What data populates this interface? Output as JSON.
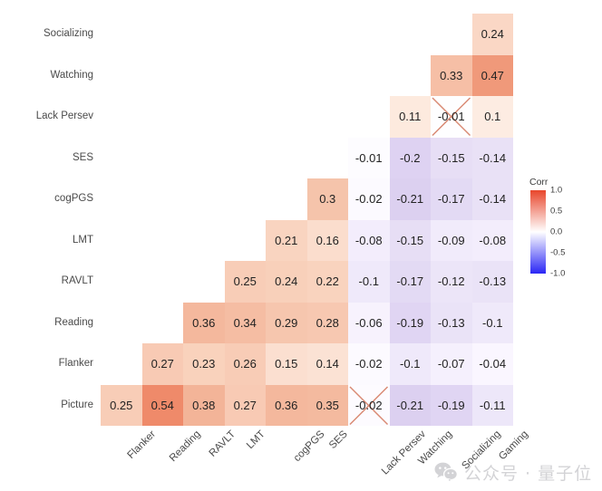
{
  "chart_data": {
    "type": "heatmap",
    "title": "",
    "xlabel": "",
    "ylabel": "",
    "legend": {
      "title": "Corr",
      "position": "right",
      "ticks": [
        "1.0",
        "0.5",
        "0.0",
        "-0.5",
        "-1.0"
      ],
      "tick_values": [
        1.0,
        0.5,
        0.0,
        -0.5,
        -1.0
      ],
      "vmin": -1.0,
      "vmax": 1.0,
      "color_high": "#e8462b",
      "color_mid": "#ffffff",
      "color_low": "#2a26f5"
    },
    "x_categories": [
      "Flanker",
      "Reading",
      "RAVLT",
      "LMT",
      "cogPGS",
      "SES",
      "Lack Persev",
      "Watching",
      "Socializing",
      "Gaming"
    ],
    "y_categories": [
      "Socializing",
      "Watching",
      "Lack Persev",
      "SES",
      "cogPGS",
      "LMT",
      "RAVLT",
      "Reading",
      "Flanker",
      "Picture"
    ],
    "lower_triangle_only": true,
    "nonsignificant_marker": "x-cross",
    "cells": [
      {
        "row": 0,
        "col": 9,
        "value": 0.24,
        "label": "0.24",
        "color": "#fad7c5",
        "crossed": false
      },
      {
        "row": 1,
        "col": 8,
        "value": 0.33,
        "label": "0.33",
        "color": "#f6bfa6",
        "crossed": false
      },
      {
        "row": 1,
        "col": 9,
        "value": 0.47,
        "label": "0.47",
        "color": "#f0997a",
        "crossed": false
      },
      {
        "row": 2,
        "col": 7,
        "value": 0.11,
        "label": "0.11",
        "color": "#fdeade",
        "crossed": false
      },
      {
        "row": 2,
        "col": 8,
        "value": -0.01,
        "label": "-0.01",
        "color": "#fefeff",
        "crossed": true
      },
      {
        "row": 2,
        "col": 9,
        "value": 0.1,
        "label": "0.1",
        "color": "#fdece2",
        "crossed": false
      },
      {
        "row": 3,
        "col": 6,
        "value": -0.01,
        "label": "-0.01",
        "color": "#fdfcff",
        "crossed": false
      },
      {
        "row": 3,
        "col": 7,
        "value": -0.2,
        "label": "-0.2",
        "color": "#ded2f2",
        "crossed": false
      },
      {
        "row": 3,
        "col": 8,
        "value": -0.15,
        "label": "-0.15",
        "color": "#e7def5",
        "crossed": false
      },
      {
        "row": 3,
        "col": 9,
        "value": -0.14,
        "label": "-0.14",
        "color": "#e9e1f6",
        "crossed": false
      },
      {
        "row": 4,
        "col": 5,
        "value": 0.3,
        "label": "0.3",
        "color": "#f5c4ab",
        "crossed": false
      },
      {
        "row": 4,
        "col": 6,
        "value": -0.02,
        "label": "-0.02",
        "color": "#fcfaff",
        "crossed": false
      },
      {
        "row": 4,
        "col": 7,
        "value": -0.21,
        "label": "-0.21",
        "color": "#dcd0f0",
        "crossed": false
      },
      {
        "row": 4,
        "col": 8,
        "value": -0.17,
        "label": "-0.17",
        "color": "#e3daf4",
        "crossed": false
      },
      {
        "row": 4,
        "col": 9,
        "value": -0.14,
        "label": "-0.14",
        "color": "#e9e1f6",
        "crossed": false
      },
      {
        "row": 5,
        "col": 4,
        "value": 0.21,
        "label": "0.21",
        "color": "#f9d4c0",
        "crossed": false
      },
      {
        "row": 5,
        "col": 5,
        "value": 0.16,
        "label": "0.16",
        "color": "#fbddcd",
        "crossed": false
      },
      {
        "row": 5,
        "col": 6,
        "value": -0.08,
        "label": "-0.08",
        "color": "#f3edfc",
        "crossed": false
      },
      {
        "row": 5,
        "col": 7,
        "value": -0.15,
        "label": "-0.15",
        "color": "#e7def5",
        "crossed": false
      },
      {
        "row": 5,
        "col": 8,
        "value": -0.09,
        "label": "-0.09",
        "color": "#f1ebfb",
        "crossed": false
      },
      {
        "row": 5,
        "col": 9,
        "value": -0.08,
        "label": "-0.08",
        "color": "#f3edfc",
        "crossed": false
      },
      {
        "row": 6,
        "col": 3,
        "value": 0.25,
        "label": "0.25",
        "color": "#f8cdb7",
        "crossed": false
      },
      {
        "row": 6,
        "col": 4,
        "value": 0.24,
        "label": "0.24",
        "color": "#f8d0ba",
        "crossed": false
      },
      {
        "row": 6,
        "col": 5,
        "value": 0.22,
        "label": "0.22",
        "color": "#f9d3be",
        "crossed": false
      },
      {
        "row": 6,
        "col": 6,
        "value": -0.1,
        "label": "-0.1",
        "color": "#efe9fa",
        "crossed": false
      },
      {
        "row": 6,
        "col": 7,
        "value": -0.17,
        "label": "-0.17",
        "color": "#e3daf4",
        "crossed": false
      },
      {
        "row": 6,
        "col": 8,
        "value": -0.12,
        "label": "-0.12",
        "color": "#ece5f8",
        "crossed": false
      },
      {
        "row": 6,
        "col": 9,
        "value": -0.13,
        "label": "-0.13",
        "color": "#eae3f7",
        "crossed": false
      },
      {
        "row": 7,
        "col": 2,
        "value": 0.36,
        "label": "0.36",
        "color": "#f4b89d",
        "crossed": false
      },
      {
        "row": 7,
        "col": 3,
        "value": 0.34,
        "label": "0.34",
        "color": "#f5bda3",
        "crossed": false
      },
      {
        "row": 7,
        "col": 4,
        "value": 0.29,
        "label": "0.29",
        "color": "#f6c6ae",
        "crossed": false
      },
      {
        "row": 7,
        "col": 5,
        "value": 0.28,
        "label": "0.28",
        "color": "#f7c8b1",
        "crossed": false
      },
      {
        "row": 7,
        "col": 6,
        "value": -0.06,
        "label": "-0.06",
        "color": "#f7f2fd",
        "crossed": false
      },
      {
        "row": 7,
        "col": 7,
        "value": -0.19,
        "label": "-0.19",
        "color": "#e0d5f3",
        "crossed": false
      },
      {
        "row": 7,
        "col": 8,
        "value": -0.13,
        "label": "-0.13",
        "color": "#eae3f7",
        "crossed": false
      },
      {
        "row": 7,
        "col": 9,
        "value": -0.1,
        "label": "-0.1",
        "color": "#efe9fa",
        "crossed": false
      },
      {
        "row": 8,
        "col": 1,
        "value": 0.27,
        "label": "0.27",
        "color": "#f8cab4",
        "crossed": false
      },
      {
        "row": 8,
        "col": 2,
        "value": 0.23,
        "label": "0.23",
        "color": "#f9d2bc",
        "crossed": false
      },
      {
        "row": 8,
        "col": 3,
        "value": 0.26,
        "label": "0.26",
        "color": "#f8ccb6",
        "crossed": false
      },
      {
        "row": 8,
        "col": 4,
        "value": 0.15,
        "label": "0.15",
        "color": "#fbdfd0",
        "crossed": false
      },
      {
        "row": 8,
        "col": 5,
        "value": 0.14,
        "label": "0.14",
        "color": "#fbe2d4",
        "crossed": false
      },
      {
        "row": 8,
        "col": 6,
        "value": -0.02,
        "label": "-0.02",
        "color": "#fcfaff",
        "crossed": false
      },
      {
        "row": 8,
        "col": 7,
        "value": -0.1,
        "label": "-0.1",
        "color": "#efe9fa",
        "crossed": false
      },
      {
        "row": 8,
        "col": 8,
        "value": -0.07,
        "label": "-0.07",
        "color": "#f5f0fd",
        "crossed": false
      },
      {
        "row": 8,
        "col": 9,
        "value": -0.04,
        "label": "-0.04",
        "color": "#faf6ff",
        "crossed": false
      },
      {
        "row": 9,
        "col": 0,
        "value": 0.25,
        "label": "0.25",
        "color": "#f8cdb7",
        "crossed": false
      },
      {
        "row": 9,
        "col": 1,
        "value": 0.54,
        "label": "0.54",
        "color": "#ef8a6a",
        "crossed": false
      },
      {
        "row": 9,
        "col": 2,
        "value": 0.38,
        "label": "0.38",
        "color": "#f3b498",
        "crossed": false
      },
      {
        "row": 9,
        "col": 3,
        "value": 0.27,
        "label": "0.27",
        "color": "#f8cab4",
        "crossed": false
      },
      {
        "row": 9,
        "col": 4,
        "value": 0.36,
        "label": "0.36",
        "color": "#f4b89d",
        "crossed": false
      },
      {
        "row": 9,
        "col": 5,
        "value": 0.35,
        "label": "0.35",
        "color": "#f4ba9f",
        "crossed": false
      },
      {
        "row": 9,
        "col": 6,
        "value": -0.02,
        "label": "-0.02",
        "color": "#fdfbff",
        "crossed": true
      },
      {
        "row": 9,
        "col": 7,
        "value": -0.21,
        "label": "-0.21",
        "color": "#dcd0f0",
        "crossed": false
      },
      {
        "row": 9,
        "col": 8,
        "value": -0.19,
        "label": "-0.19",
        "color": "#e0d5f3",
        "crossed": false
      },
      {
        "row": 9,
        "col": 9,
        "value": -0.11,
        "label": "-0.11",
        "color": "#ede7f9",
        "crossed": false
      }
    ]
  },
  "watermark": {
    "text": "公众号 · 量子位",
    "icon": "wechat-icon"
  }
}
